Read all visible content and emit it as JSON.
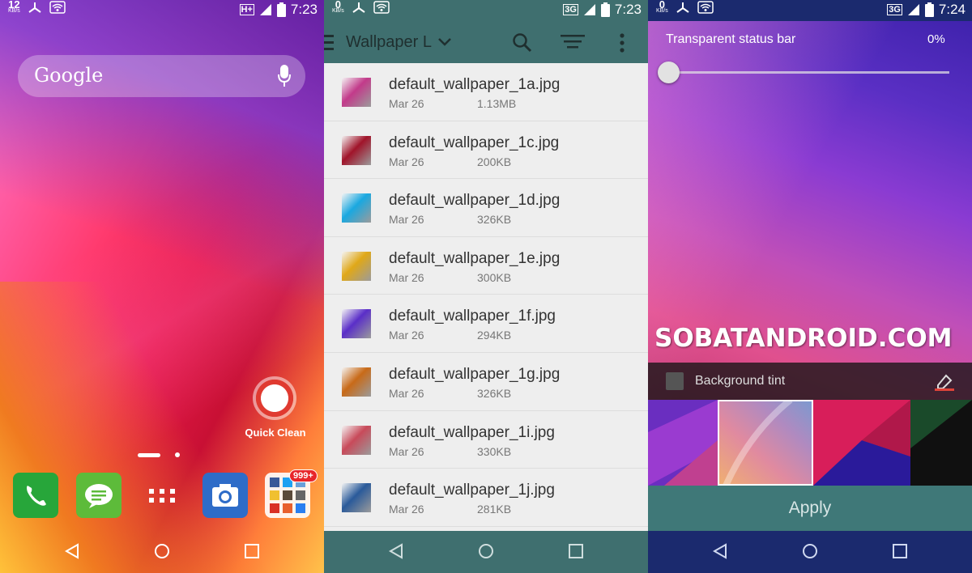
{
  "home": {
    "status": {
      "speed": "12",
      "speed_unit": "KB/s",
      "network": "H+",
      "time": "7:23"
    },
    "search": {
      "logo_text": "Google"
    },
    "quick_clean_label": "Quick Clean",
    "folder_badge": "999+"
  },
  "files": {
    "status": {
      "speed": "0",
      "speed_unit": "KB/s",
      "network": "3G",
      "time": "7:23"
    },
    "toolbar": {
      "title": "Wallpaper L"
    },
    "items": [
      {
        "name": "default_wallpaper_1a.jpg",
        "date": "Mar 26",
        "size": "1.13MB",
        "color": "#c23a8a"
      },
      {
        "name": "default_wallpaper_1c.jpg",
        "date": "Mar 26",
        "size": "200KB",
        "color": "#a0142a"
      },
      {
        "name": "default_wallpaper_1d.jpg",
        "date": "Mar 26",
        "size": "326KB",
        "color": "#1aa8e0"
      },
      {
        "name": "default_wallpaper_1e.jpg",
        "date": "Mar 26",
        "size": "300KB",
        "color": "#e0a818"
      },
      {
        "name": "default_wallpaper_1f.jpg",
        "date": "Mar 26",
        "size": "294KB",
        "color": "#5a2ec8"
      },
      {
        "name": "default_wallpaper_1g.jpg",
        "date": "Mar 26",
        "size": "326KB",
        "color": "#c86a18"
      },
      {
        "name": "default_wallpaper_1i.jpg",
        "date": "Mar 26",
        "size": "330KB",
        "color": "#c84a5a"
      },
      {
        "name": "default_wallpaper_1j.jpg",
        "date": "Mar 26",
        "size": "281KB",
        "color": "#2a5a9a"
      }
    ]
  },
  "settings": {
    "status": {
      "speed": "0",
      "speed_unit": "KB/s",
      "network": "3G",
      "time": "7:24"
    },
    "transparent_label": "Transparent status bar",
    "transparent_value": "0%",
    "transparency_level": 0,
    "watermark": "SOBATANDROID.COM",
    "background_tint_label": "Background tint",
    "apply_label": "Apply"
  }
}
